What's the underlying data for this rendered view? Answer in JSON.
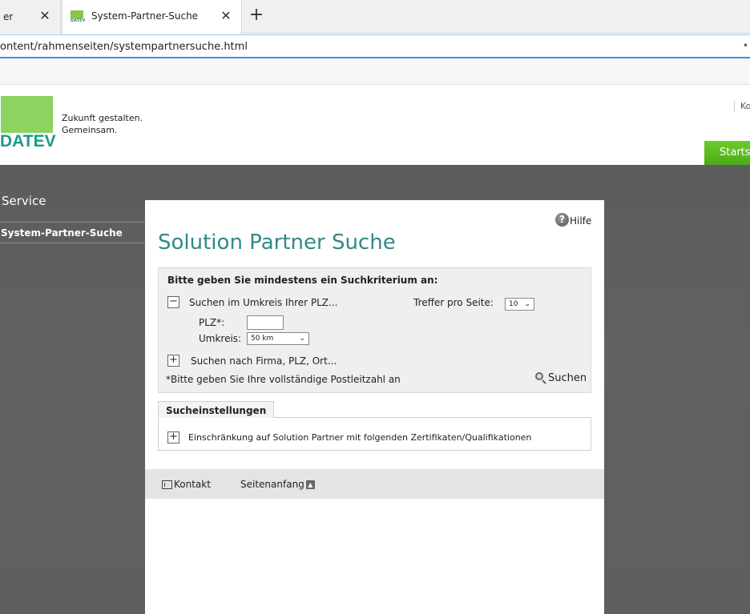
{
  "browser": {
    "tabs": [
      {
        "title": "er",
        "active": false
      },
      {
        "title": "System-Partner-Suche",
        "active": true,
        "favicon_text": "DATEV"
      }
    ],
    "new_tab_label": "+",
    "close_glyph": "✕",
    "url": "ontent/rahmenseiten/systempartnersuche.html",
    "url_overflow": "•"
  },
  "header": {
    "logo_text": "DATEV",
    "slogan_line1": "Zukunft gestalten.",
    "slogan_line2": "Gemeinsam.",
    "right_link": "Ko",
    "start_button": "Starts",
    "brand_green": "#8cd35f",
    "brand_teal": "#1a9a8a"
  },
  "sidebar": {
    "title": "Service",
    "items": [
      {
        "label": "System-Partner-Suche",
        "active": true
      }
    ]
  },
  "main": {
    "help_label": "Hilfe",
    "help_icon": "?",
    "title": "Solution Partner Suche",
    "search": {
      "heading": "Bitte geben Sie mindestens ein Suchkriterium an:",
      "radius_toggle": "−",
      "radius_label": "Suchen im Umkreis Ihrer PLZ...",
      "hits_label": "Treffer pro Seite:",
      "hits_value": "10",
      "plz_label": "PLZ*:",
      "plz_value": "",
      "umkreis_label": "Umkreis:",
      "umkreis_value": "50 km",
      "company_toggle": "+",
      "company_label": "Suchen nach Firma, PLZ, Ort...",
      "hint": "*Bitte geben Sie Ihre vollständige Postleitzahl an",
      "search_button": "Suchen"
    },
    "settings": {
      "tab_label": "Sucheinstellungen",
      "toggle": "+",
      "restriction_label": "Einschränkung auf Solution Partner mit folgenden Zertifikaten/Qualifikationen"
    },
    "footer": {
      "contact_label": "Kontakt",
      "top_label": "Seitenanfang",
      "top_icon": "▲"
    }
  }
}
